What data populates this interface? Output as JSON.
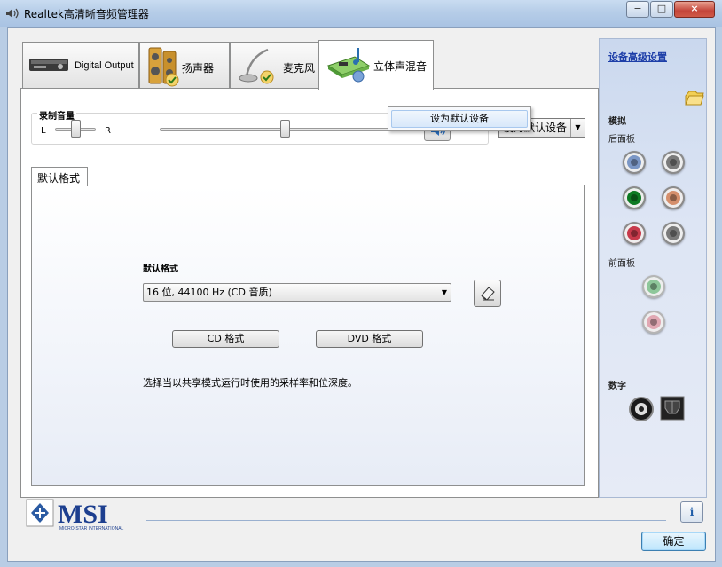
{
  "window": {
    "title": "Realtek高清晰音频管理器",
    "min_label": "−",
    "max_label": "□",
    "close_label": "×"
  },
  "tabs": [
    {
      "label": "Digital Output",
      "icon": "digital-output-device-icon"
    },
    {
      "label": "扬声器",
      "icon": "speaker-icon"
    },
    {
      "label": "麦克风",
      "icon": "microphone-icon"
    },
    {
      "label": "立体声混音",
      "icon": "stereo-mix-icon",
      "active": true
    }
  ],
  "popup": {
    "item_label": "设为默认设备"
  },
  "volume": {
    "title": "录制音量",
    "left_label": "L",
    "right_label": "R",
    "balance_fraction": 0.5,
    "level_fraction": 0.5
  },
  "default_device_combo": {
    "label": "设为默认设备"
  },
  "format": {
    "tab_label": "默认格式",
    "section_label": "默认格式",
    "selected": "16 位, 44100 Hz (CD 音质)",
    "cd_button": "CD 格式",
    "dvd_button": "DVD 格式",
    "description": "选择当以共享模式运行时使用的采样率和位深度。"
  },
  "right_panel": {
    "advanced_link": "设备高级设置",
    "analog_heading": "模拟",
    "rear_panel_label": "后面板",
    "front_panel_label": "前面板",
    "digital_heading": "数字",
    "rear_jack_colors": [
      "#7b97c6",
      "#7a7a7a",
      "#0d7a23",
      "#d58f6c",
      "#c73a4b",
      "#7a7a7a"
    ],
    "front_jack_colors": [
      "#8ec79a",
      "#e1a8b3"
    ]
  },
  "footer": {
    "brand": "MSI",
    "brand_sub": "MICRO-STAR INTERNATIONAL",
    "info_label": "i",
    "ok_label": "确定"
  }
}
